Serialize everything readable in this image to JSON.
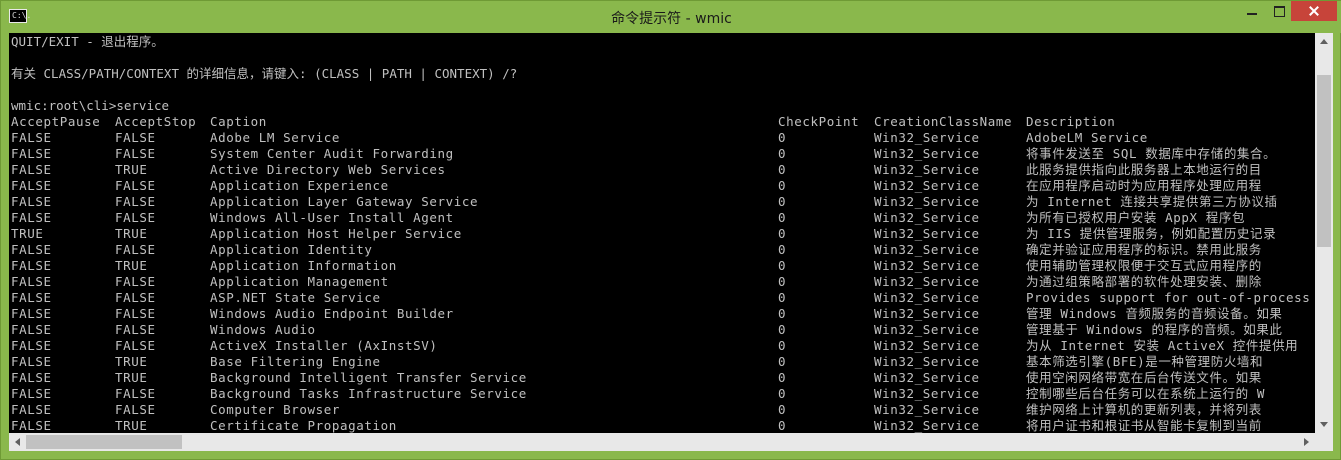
{
  "window": {
    "title": "命令提示符 - wmic",
    "icon": "console-app-icon",
    "icon_text": "C:\\."
  },
  "console": {
    "intro_lines": [
      "QUIT/EXIT - 退出程序。",
      "有关 CLASS/PATH/CONTEXT 的详细信息，请键入: (CLASS | PATH | CONTEXT) /?",
      "wmic:root\\cli>service"
    ],
    "headers": [
      "AcceptPause",
      "AcceptStop",
      "Caption",
      "CheckPoint",
      "CreationClassName",
      "Description"
    ],
    "rows": [
      [
        "FALSE",
        "FALSE",
        "Adobe LM Service",
        "0",
        "Win32_Service",
        "AdobeLM Service"
      ],
      [
        "FALSE",
        "FALSE",
        "System Center Audit Forwarding",
        "0",
        "Win32_Service",
        "将事件发送至 SQL 数据库中存储的集合。"
      ],
      [
        "FALSE",
        "TRUE",
        "Active Directory Web Services",
        "0",
        "Win32_Service",
        "此服务提供指向此服务器上本地运行的目"
      ],
      [
        "FALSE",
        "FALSE",
        "Application Experience",
        "0",
        "Win32_Service",
        "在应用程序启动时为应用程序处理应用程"
      ],
      [
        "FALSE",
        "FALSE",
        "Application Layer Gateway Service",
        "0",
        "Win32_Service",
        "为 Internet 连接共享提供第三方协议插"
      ],
      [
        "FALSE",
        "FALSE",
        "Windows All-User Install Agent",
        "0",
        "Win32_Service",
        "为所有已授权用户安装 AppX 程序包"
      ],
      [
        "TRUE",
        "TRUE",
        "Application Host Helper Service",
        "0",
        "Win32_Service",
        "为 IIS 提供管理服务，例如配置历史记录"
      ],
      [
        "FALSE",
        "FALSE",
        "Application Identity",
        "0",
        "Win32_Service",
        "确定并验证应用程序的标识。禁用此服务"
      ],
      [
        "FALSE",
        "TRUE",
        "Application Information",
        "0",
        "Win32_Service",
        "使用辅助管理权限便于交互式应用程序的"
      ],
      [
        "FALSE",
        "FALSE",
        "Application Management",
        "0",
        "Win32_Service",
        "为通过组策略部署的软件处理安装、删除"
      ],
      [
        "FALSE",
        "FALSE",
        "ASP.NET State Service",
        "0",
        "Win32_Service",
        "Provides support for out-of-process"
      ],
      [
        "FALSE",
        "FALSE",
        "Windows Audio Endpoint Builder",
        "0",
        "Win32_Service",
        "管理 Windows 音频服务的音频设备。如果"
      ],
      [
        "FALSE",
        "FALSE",
        "Windows Audio",
        "0",
        "Win32_Service",
        "管理基于 Windows 的程序的音频。如果此"
      ],
      [
        "FALSE",
        "FALSE",
        "ActiveX Installer (AxInstSV)",
        "0",
        "Win32_Service",
        "为从 Internet 安装 ActiveX 控件提供用"
      ],
      [
        "FALSE",
        "TRUE",
        "Base Filtering Engine",
        "0",
        "Win32_Service",
        "基本筛选引擎(BFE)是一种管理防火墙和"
      ],
      [
        "FALSE",
        "TRUE",
        "Background Intelligent Transfer Service",
        "0",
        "Win32_Service",
        "使用空闲网络带宽在后台传送文件。如果"
      ],
      [
        "FALSE",
        "FALSE",
        "Background Tasks Infrastructure Service",
        "0",
        "Win32_Service",
        "控制哪些后台任务可以在系统上运行的 W"
      ],
      [
        "FALSE",
        "FALSE",
        "Computer Browser",
        "0",
        "Win32_Service",
        "维护网络上计算机的更新列表，并将列表"
      ],
      [
        "FALSE",
        "TRUE",
        "Certificate Propagation",
        "0",
        "Win32_Service",
        "将用户证书和根证书从智能卡复制到当前"
      ]
    ]
  },
  "scrollbars": {
    "vertical": {
      "position_fraction": 0.11
    },
    "horizontal": {
      "position_fraction": 0.0
    }
  }
}
